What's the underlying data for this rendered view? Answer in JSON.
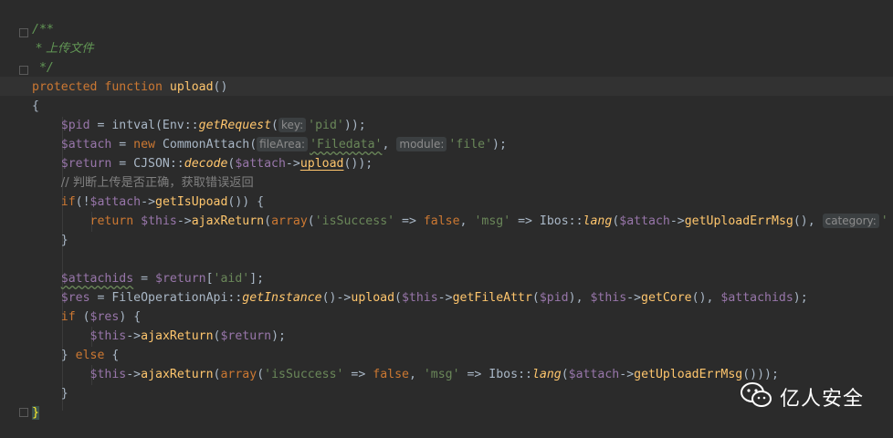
{
  "code": {
    "doc_open": "/**",
    "doc_comment": " * 上传文件",
    "doc_close": " */",
    "kw_protected": "protected",
    "kw_function": "function",
    "fn_upload": "upload",
    "paren_open_close": "()",
    "brace_open": "{",
    "l5": {
      "var": "$pid",
      "op": " = intval(Env::",
      "m": "getRequest",
      "p": "(",
      "hint": "key:",
      "str": "'pid'",
      "end": "));"
    },
    "l6": {
      "var": "$attach",
      "op": " = ",
      "kw": "new",
      "cls": " CommonAttach(",
      "hint1": "fileArea:",
      "str1": "'Filedata'",
      "sep": ", ",
      "hint2": "module:",
      "str2": "'file'",
      "end": ");"
    },
    "l7": {
      "var": "$return",
      "op": " = CJSON::",
      "m": "decode",
      "p": "(",
      "var2": "$attach",
      "arr": "->",
      "m2": "upload",
      "end": "());"
    },
    "l8": {
      "cmt": "// 判断上传是否正确，获取错误返回"
    },
    "l9": {
      "kw": "if",
      "p": "(!",
      "var": "$attach",
      "arr": "->",
      "m": "getIsUpoad",
      "end": "()) {"
    },
    "l10": {
      "kw": "return",
      "sp": " ",
      "var": "$this",
      "arr": "->",
      "m": "ajaxReturn",
      "p1": "(",
      "kw2": "array",
      "p2": "(",
      "s1": "'isSuccess'",
      "a1": " => ",
      "kw3": "false",
      "c1": ", ",
      "s2": "'msg'",
      "a2": " => Ibos::",
      "m2": "lang",
      "p3": "(",
      "var2": "$attach",
      "arr2": "->",
      "m3": "getUploadErrMsg",
      "p4": "(), ",
      "hint": "category:",
      "tail": "'"
    },
    "l11": {
      "text": "}"
    },
    "l13": {
      "var": "$attachids",
      "op": " = ",
      "var2": "$return",
      "b": "[",
      "str": "'aid'",
      "end": "];"
    },
    "l14": {
      "var": "$res",
      "op": " = FileOperationApi::",
      "m": "getInstance",
      "p": "()->",
      "m2": "upload",
      "p2": "(",
      "var2": "$this",
      "arr": "->",
      "m3": "getFileAttr",
      "p3": "(",
      "var3": "$pid",
      "c": "), ",
      "var4": "$this",
      "arr2": "->",
      "m4": "getCore",
      "c2": "(), ",
      "var5": "$attachids",
      "end": ");"
    },
    "l15": {
      "kw": "if",
      "p": " (",
      "var": "$res",
      "end": ") {"
    },
    "l16": {
      "var": "$this",
      "arr": "->",
      "m": "ajaxReturn",
      "p": "(",
      "var2": "$return",
      "end": ");"
    },
    "l17": {
      "b": "} ",
      "kw": "else",
      "end": " {"
    },
    "l18": {
      "var": "$this",
      "arr": "->",
      "m": "ajaxReturn",
      "p1": "(",
      "kw": "array",
      "p2": "(",
      "s1": "'isSuccess'",
      "a1": " => ",
      "kw2": "false",
      "c1": ", ",
      "s2": "'msg'",
      "a2": " => Ibos::",
      "m2": "lang",
      "p3": "(",
      "var2": "$attach",
      "arr2": "->",
      "m3": "getUploadErrMsg",
      "end": "()));"
    },
    "l19": {
      "text": "}"
    },
    "l20": {
      "text": "}"
    }
  },
  "watermark": {
    "label": "亿人安全",
    "icon": "wechat-icon"
  },
  "colors": {
    "background": "#2b2b2b",
    "keyword": "#cc7832",
    "function": "#ffc66d",
    "variable": "#9876aa",
    "string": "#6a8759",
    "doc_comment": "#629755",
    "comment": "#808080"
  }
}
